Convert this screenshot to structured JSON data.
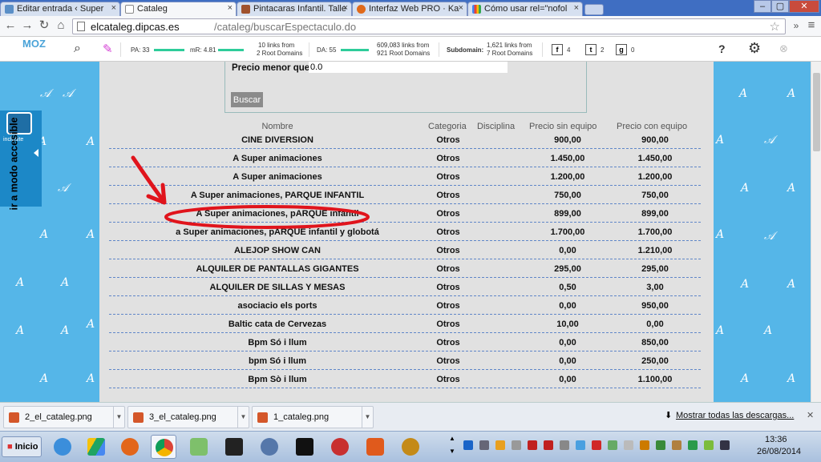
{
  "browser": {
    "tabs": [
      {
        "label": "Editar entrada ‹ Super",
        "icon": "wordpress-icon",
        "active": false
      },
      {
        "label": "Cataleg",
        "icon": "page-icon",
        "active": true
      },
      {
        "label": "Pintacaras Infantil. Talle",
        "icon": "site-icon",
        "active": false
      },
      {
        "label": "Interfaz Web PRO · Ka",
        "icon": "firefox-icon",
        "active": false
      },
      {
        "label": "Cómo usar rel=\"nofol",
        "icon": "google-icon",
        "active": false
      }
    ],
    "url_host": "elcataleg.dipcas.es",
    "url_path": "/cataleg/buscarEspectaculo.do"
  },
  "mozbar": {
    "logo": "MOZ",
    "pa": "PA: 33",
    "mr": "mR: 4.81",
    "links1_line1": "10 links from",
    "links1_line2": "2 Root Domains",
    "da": "DA: 55",
    "links2_line1": "609,083 links from",
    "links2_line2": "921 Root Domains",
    "subdomain": "Subdomain:",
    "links3_line1": "1,621 links from",
    "links3_line2": "7 Root Domains",
    "facebook": "4",
    "twitter": "2",
    "gplus": "0",
    "help": "?"
  },
  "search_form": {
    "price_label": "Precio menor que",
    "price_value": "0.0",
    "button_label": "Buscar"
  },
  "table": {
    "headers": [
      "Nombre",
      "Categoria",
      "Disciplina",
      "Precio sin equipo",
      "Precio con equipo"
    ],
    "rows": [
      [
        "CINE DIVERSION",
        "Otros",
        "",
        "900,00",
        "900,00"
      ],
      [
        "A Super animaciones",
        "Otros",
        "",
        "1.450,00",
        "1.450,00"
      ],
      [
        "A Super animaciones",
        "Otros",
        "",
        "1.200,00",
        "1.200,00"
      ],
      [
        "A Super animaciones, PARQUE INFANTIL",
        "Otros",
        "",
        "750,00",
        "750,00"
      ],
      [
        "A Super animaciones, pARQUE infantil",
        "Otros",
        "",
        "899,00",
        "899,00"
      ],
      [
        "a Super animaciones, pARQUE infantil y globotá",
        "Otros",
        "",
        "1.700,00",
        "1.700,00"
      ],
      [
        "ALEJOP SHOW CAN",
        "Otros",
        "",
        "0,00",
        "1.210,00"
      ],
      [
        "ALQUILER DE PANTALLAS GIGANTES",
        "Otros",
        "",
        "295,00",
        "295,00"
      ],
      [
        "ALQUILER DE SILLAS Y MESAS",
        "Otros",
        "",
        "0,50",
        "3,00"
      ],
      [
        "asociacio els ports",
        "Otros",
        "",
        "0,00",
        "950,00"
      ],
      [
        "Baltic cata de Cervezas",
        "Otros",
        "",
        "10,00",
        "0,00"
      ],
      [
        "Bpm Só i llum",
        "Otros",
        "",
        "0,00",
        "850,00"
      ],
      [
        "bpm Só i llum",
        "Otros",
        "",
        "0,00",
        "250,00"
      ],
      [
        "Bpm Sò i llum",
        "Otros",
        "",
        "0,00",
        "1.100,00"
      ]
    ]
  },
  "inclusite": {
    "brand": "inclusite",
    "vertical_text": "ir a modo accesible"
  },
  "downloads": {
    "files": [
      "2_el_cataleg.png",
      "3_el_cataleg.png",
      "1_cataleg.png"
    ],
    "show_all": "Mostrar todas las descargas..."
  },
  "taskbar": {
    "start": "Inicio",
    "time": "13:36",
    "date": "26/08/2014"
  },
  "colors": {
    "page_bg": "#55b6e8",
    "content_bg": "#e1e1e1",
    "annotation": "#e0141c",
    "row_divider": "#5f86c8"
  }
}
